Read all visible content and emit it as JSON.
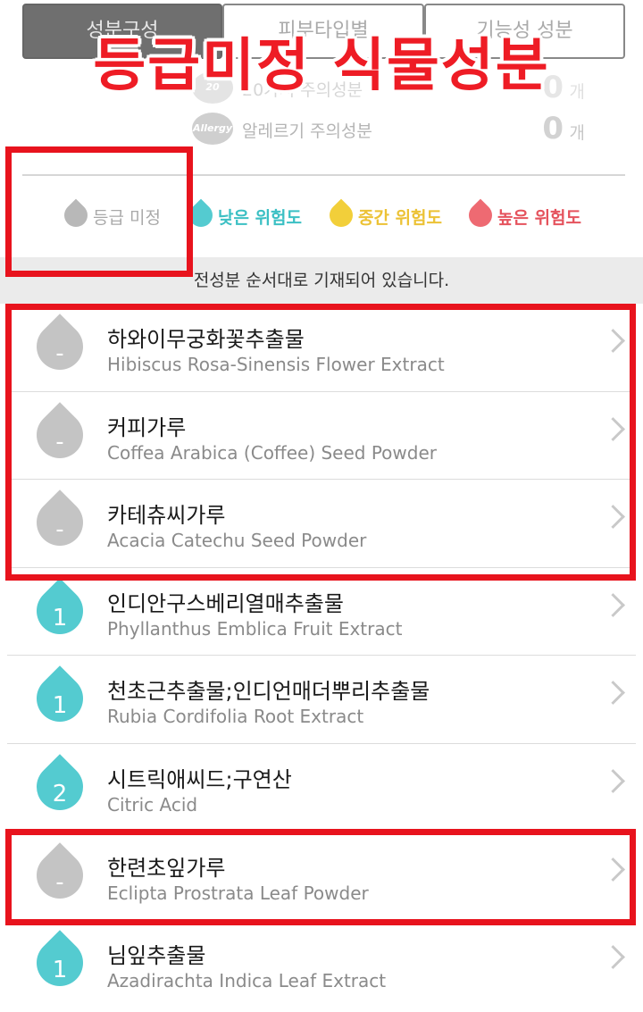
{
  "tabs": [
    {
      "label": "성분구성"
    },
    {
      "label": "피부타입별"
    },
    {
      "label": "기능성 성분"
    }
  ],
  "headline": "등급미정 식물성분",
  "caution": {
    "row20": {
      "icon": "20",
      "label": "20가지 주의성분",
      "count": "0",
      "unit": "개"
    },
    "allergy": {
      "icon": "Allergy",
      "label": "알레르기 주의성분",
      "count": "0",
      "unit": "개"
    }
  },
  "legend": {
    "none": "등급 미정",
    "low": "낮은 위험도",
    "mid": "중간 위험도",
    "high": "높은 위험도"
  },
  "notice": "전성분 순서대로 기재되어 있습니다.",
  "ingredients": [
    {
      "grade": "-",
      "kr": "하와이무궁화꽃추출물",
      "en": "Hibiscus Rosa-Sinensis Flower Extract"
    },
    {
      "grade": "-",
      "kr": "커피가루",
      "en": "Coffea Arabica (Coffee) Seed Powder"
    },
    {
      "grade": "-",
      "kr": "카테츄씨가루",
      "en": "Acacia Catechu Seed Powder"
    },
    {
      "grade": "1",
      "kr": "인디안구스베리열매추출물",
      "en": "Phyllanthus Emblica Fruit Extract"
    },
    {
      "grade": "1",
      "kr": "천초근추출물;인디언매더뿌리추출물",
      "en": "Rubia Cordifolia Root Extract"
    },
    {
      "grade": "2",
      "kr": "시트릭애씨드;구연산",
      "en": "Citric Acid"
    },
    {
      "grade": "-",
      "kr": "한련초잎가루",
      "en": "Eclipta Prostrata Leaf Powder"
    },
    {
      "grade": "1",
      "kr": "님잎추출물",
      "en": "Azadirachta Indica Leaf Extract"
    }
  ],
  "colors": {
    "highlight": "#e8131d",
    "grade_none": "#c4c4c4",
    "grade_low": "#54cbd0",
    "grade_mid": "#f2cf3a",
    "grade_high": "#ee6a72"
  }
}
